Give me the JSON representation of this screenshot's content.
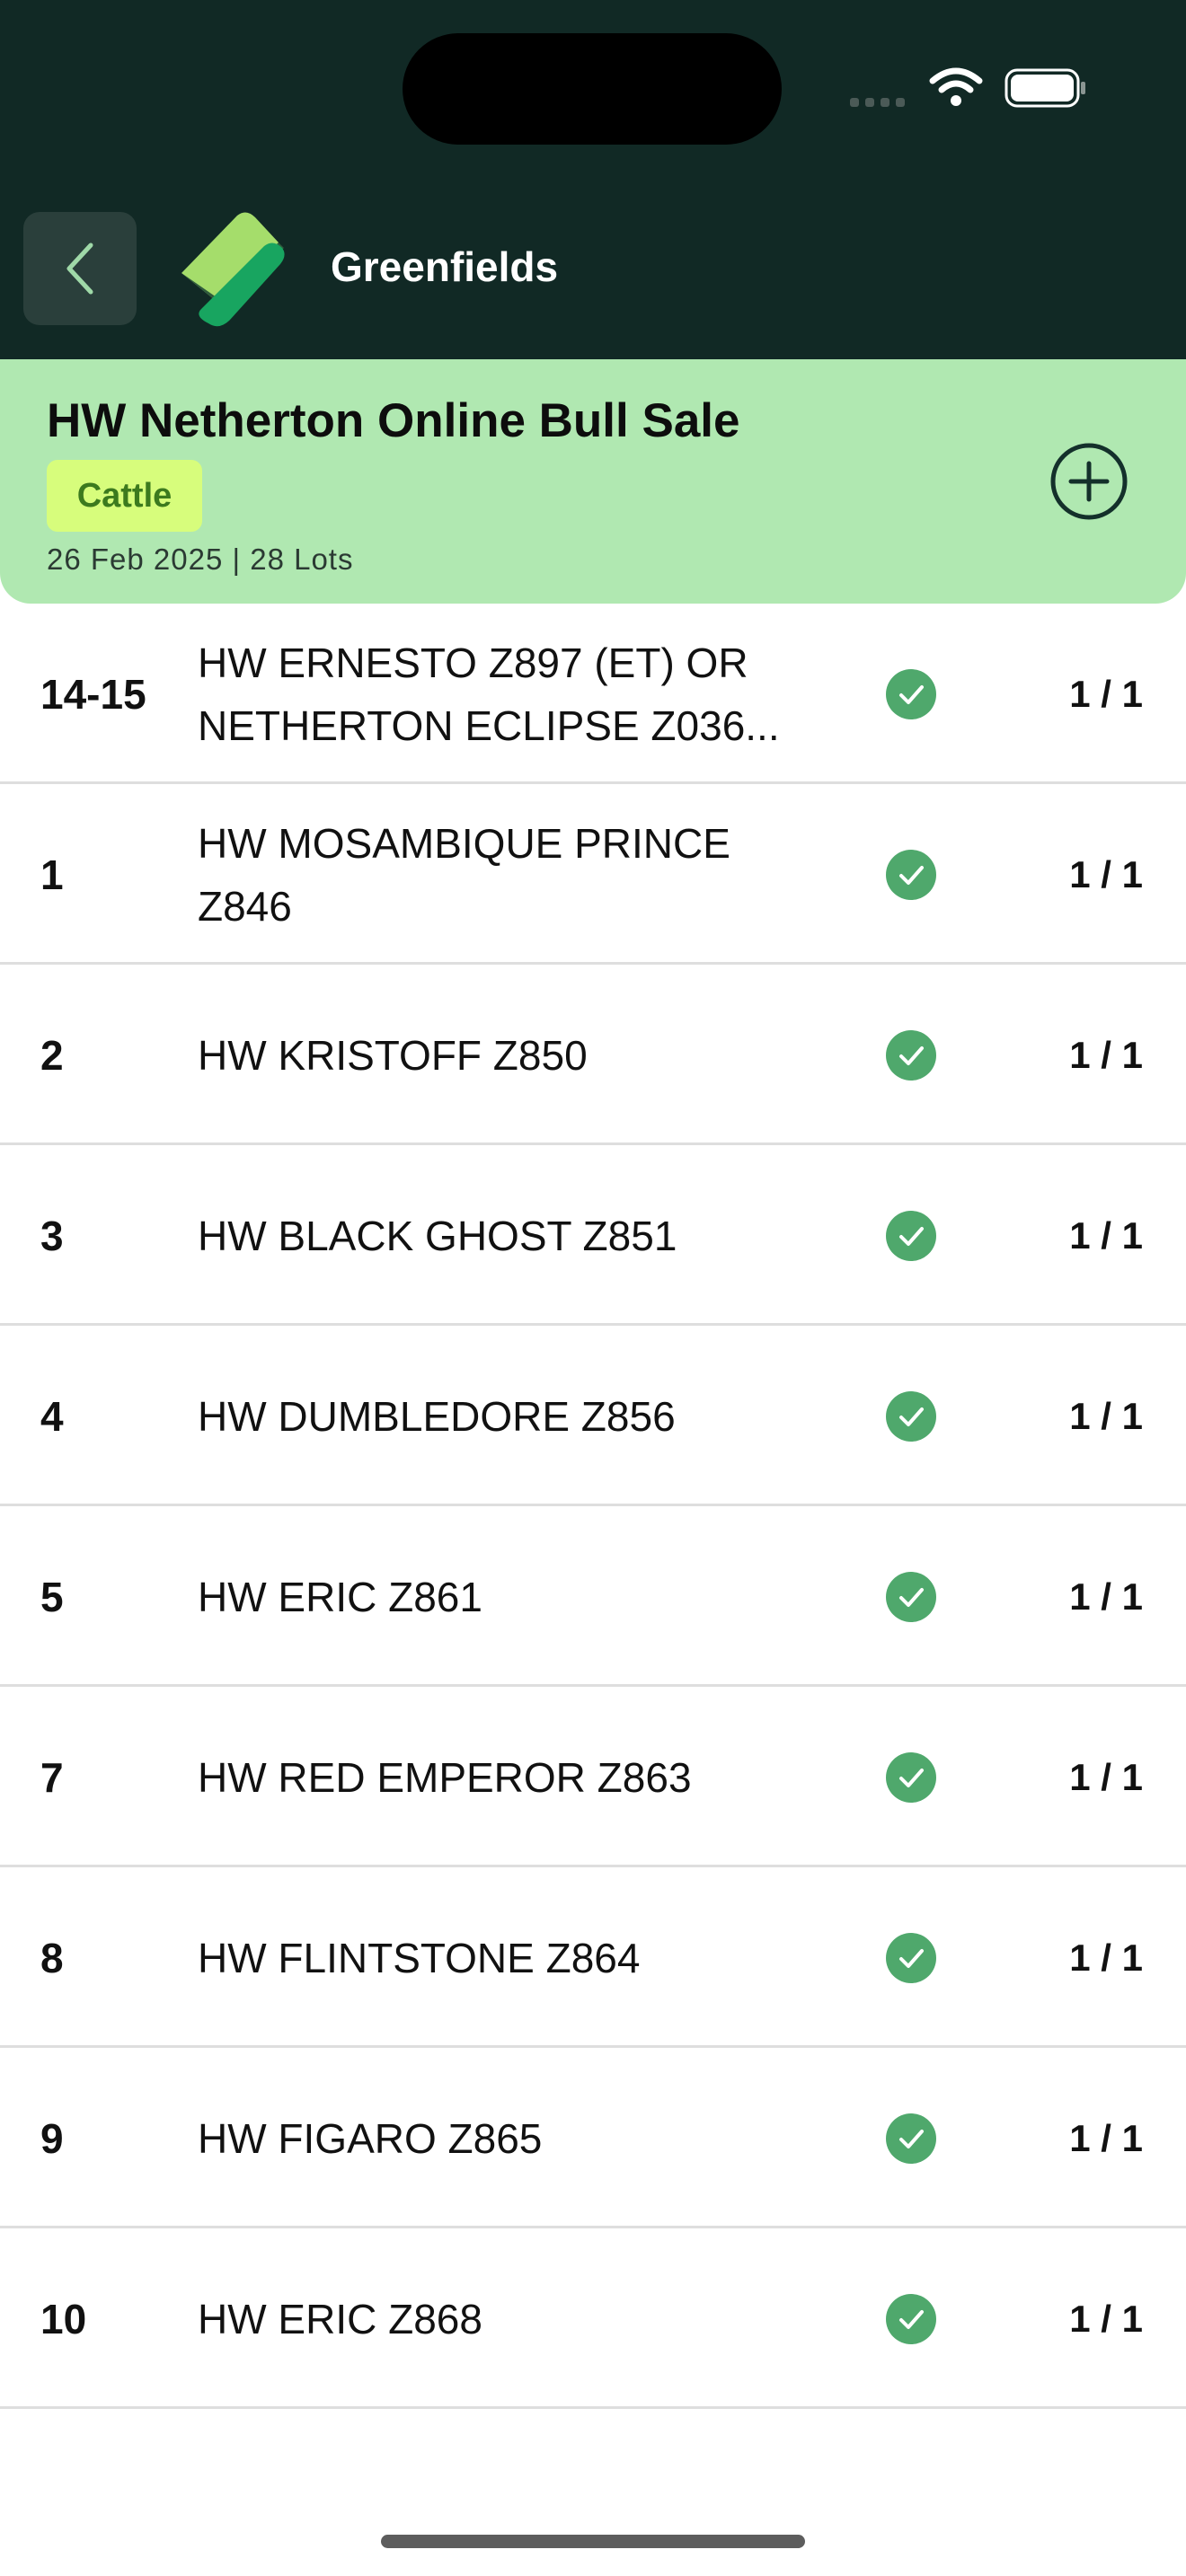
{
  "app": {
    "brand": "Greenfields",
    "accent": "#b0e8b1",
    "header_bg": "#112925",
    "check_color": "#4fa86c"
  },
  "icons": {
    "back": "chevron-left-icon",
    "logo": "greenfields-logo",
    "add": "plus-circle-icon",
    "status": "check-circle-icon"
  },
  "sale": {
    "title": "HW Netherton Online Bull Sale",
    "tag": "Cattle",
    "meta": "26 Feb 2025 | 28 Lots"
  },
  "lots": [
    {
      "number": "14-15",
      "name": "HW ERNESTO Z897 (ET) OR NETHERTON ECLIPSE Z036...",
      "count": "1 / 1"
    },
    {
      "number": "1",
      "name": "HW MOSAMBIQUE PRINCE Z846",
      "count": "1 / 1"
    },
    {
      "number": "2",
      "name": "HW KRISTOFF Z850",
      "count": "1 / 1"
    },
    {
      "number": "3",
      "name": "HW BLACK GHOST Z851",
      "count": "1 / 1"
    },
    {
      "number": "4",
      "name": "HW DUMBLEDORE Z856",
      "count": "1 / 1"
    },
    {
      "number": "5",
      "name": "HW ERIC Z861",
      "count": "1 / 1"
    },
    {
      "number": "7",
      "name": "HW RED EMPEROR Z863",
      "count": "1 / 1"
    },
    {
      "number": "8",
      "name": "HW FLINTSTONE Z864",
      "count": "1 / 1"
    },
    {
      "number": "9",
      "name": "HW FIGARO Z865",
      "count": "1 / 1"
    },
    {
      "number": "10",
      "name": "HW ERIC Z868",
      "count": "1 / 1"
    }
  ]
}
